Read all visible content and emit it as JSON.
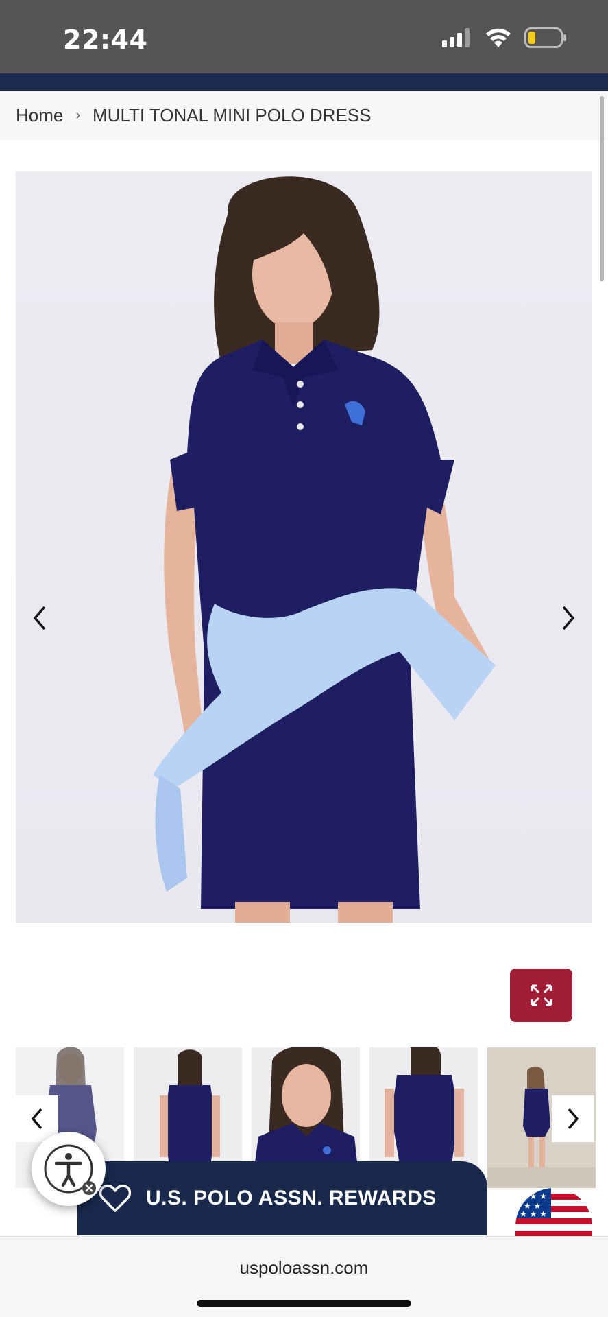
{
  "status_bar": {
    "time": "22:44"
  },
  "breadcrumb": {
    "home": "Home",
    "separator": "›",
    "current": "MULTI TONAL MINI POLO DRESS"
  },
  "gallery": {
    "prev_icon": "chevron-left-icon",
    "next_icon": "chevron-right-icon",
    "expand_icon": "expand-icon",
    "thumbnail_count": 5
  },
  "rewards": {
    "label": "U.S. POLO ASSN. REWARDS",
    "icon": "heart-icon"
  },
  "accessibility": {
    "icon": "accessibility-icon"
  },
  "browser": {
    "url": "uspoloassn.com"
  },
  "colors": {
    "navy": "#1c2a4f",
    "accent": "#a11d36",
    "rewards_bg": "#18294c"
  }
}
